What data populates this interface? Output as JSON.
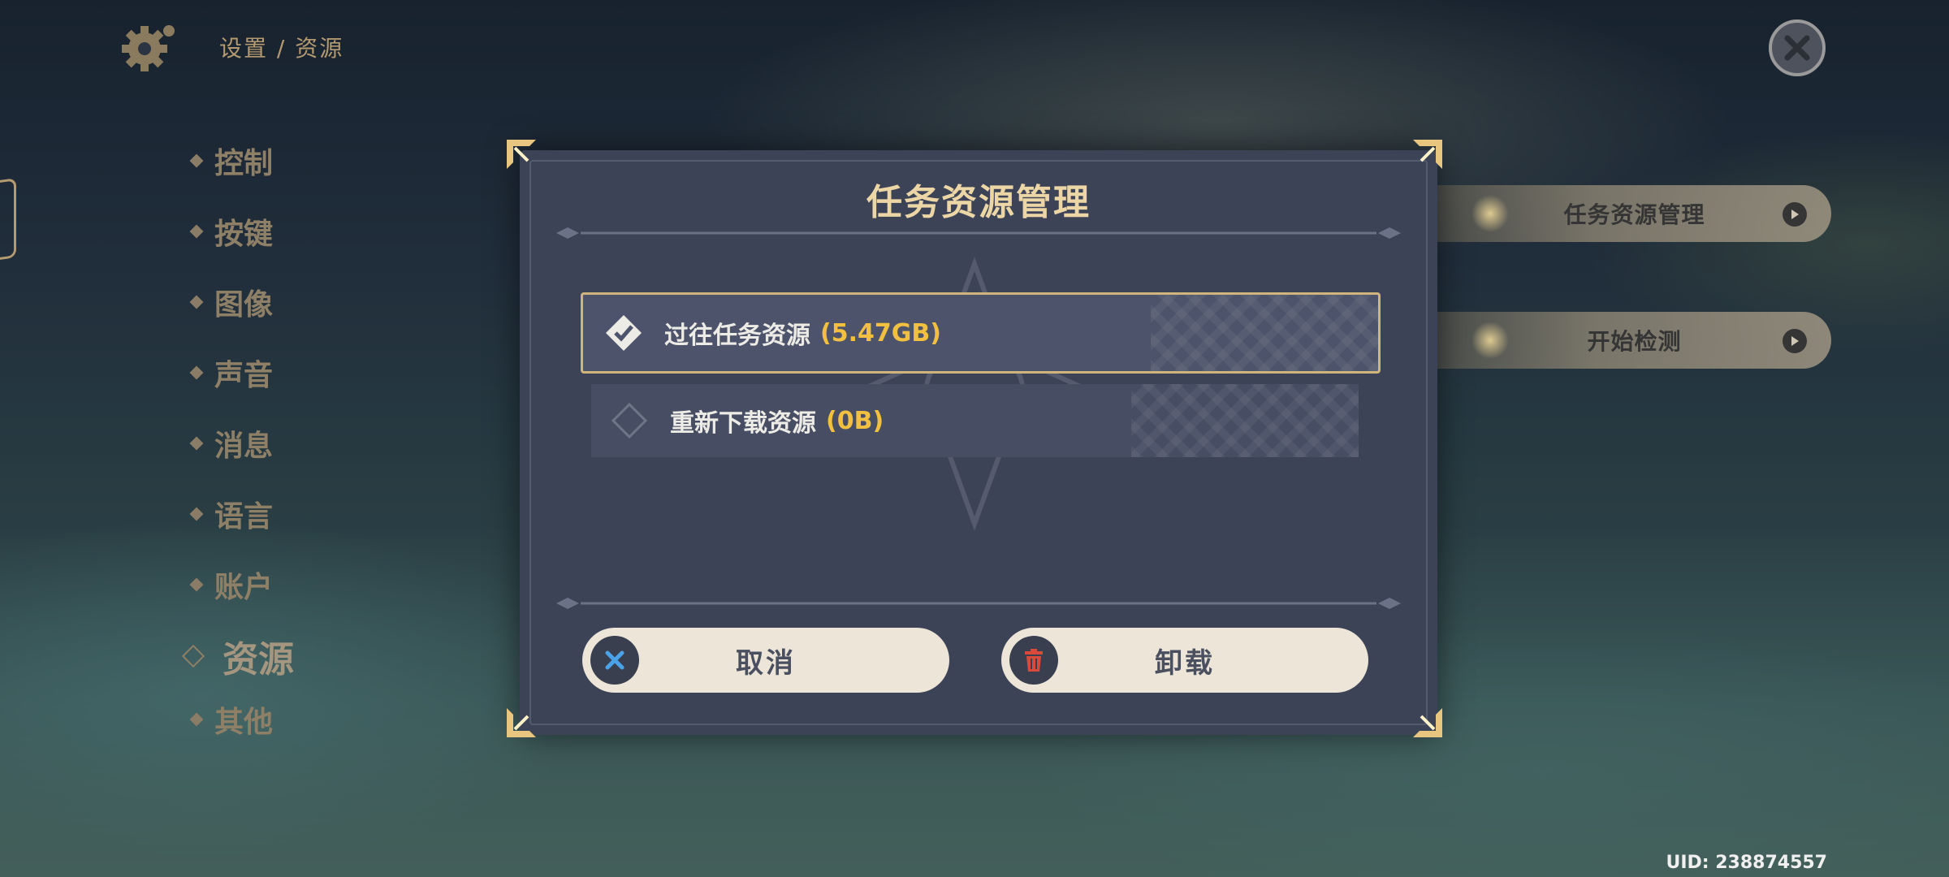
{
  "header": {
    "breadcrumb": "设置 / 资源",
    "uid": "UID: 238874557"
  },
  "menu": {
    "items": [
      {
        "label": "控制"
      },
      {
        "label": "按键"
      },
      {
        "label": "图像"
      },
      {
        "label": "声音"
      },
      {
        "label": "消息"
      },
      {
        "label": "语言"
      },
      {
        "label": "账户"
      },
      {
        "label": "资源",
        "active": true
      },
      {
        "label": "其他"
      }
    ]
  },
  "right_panel": {
    "buttons": [
      {
        "label": "任务资源管理"
      },
      {
        "label": "开始检测"
      }
    ]
  },
  "dialog": {
    "title": "任务资源管理",
    "options": [
      {
        "label": "过往任务资源",
        "size": "(5.47GB)",
        "selected": true
      },
      {
        "label": "重新下载资源",
        "size": "(0B)",
        "selected": false
      }
    ],
    "cancel_label": "取消",
    "uninstall_label": "卸载"
  },
  "colors": {
    "accent_gold": "#ecd6a6",
    "size_yellow": "#f1c040",
    "dialog_bg": "#3d4357",
    "button_bg": "#ece5d8",
    "cancel_icon": "#4aa3e8",
    "uninstall_icon": "#d94a3a"
  }
}
